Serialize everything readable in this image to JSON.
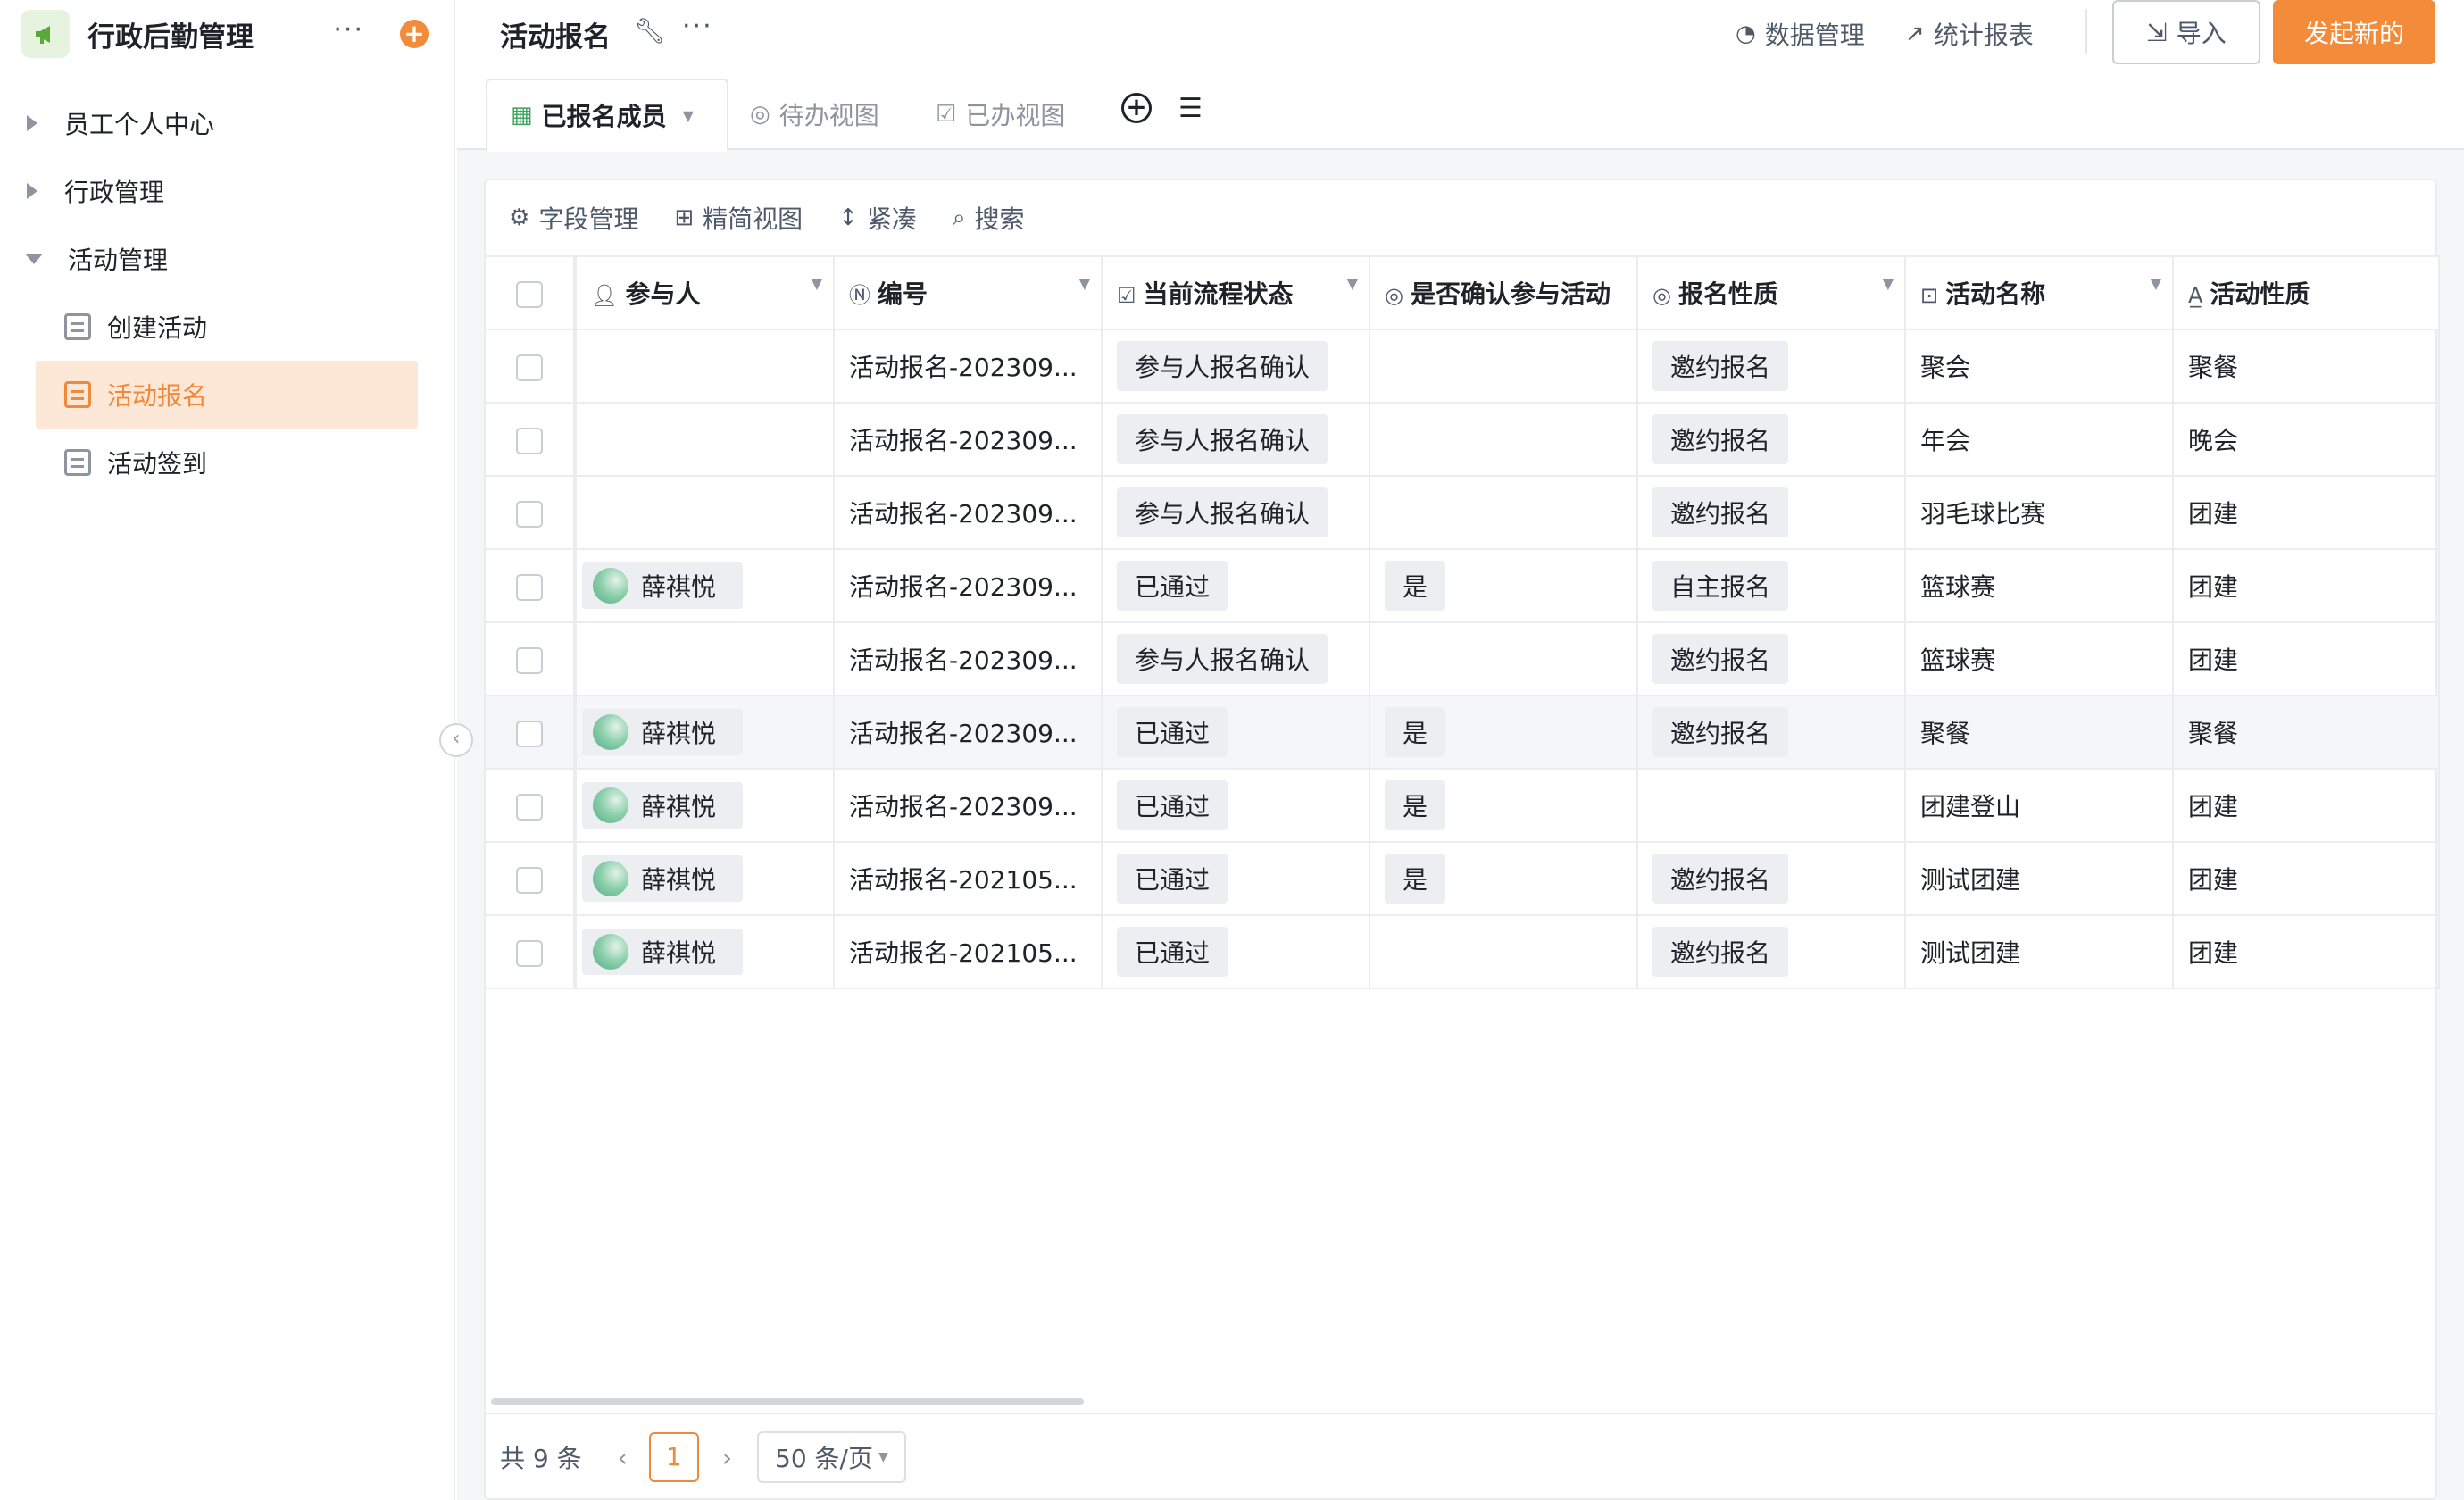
{
  "app": {
    "title": "行政后勤管理",
    "more": "···",
    "add": "+"
  },
  "sidebar": {
    "groups": [
      {
        "label": "员工个人中心"
      },
      {
        "label": "行政管理"
      },
      {
        "label": "活动管理"
      }
    ],
    "subitems": [
      {
        "label": "创建活动"
      },
      {
        "label": "活动报名"
      },
      {
        "label": "活动签到"
      }
    ],
    "active": "活动报名"
  },
  "header": {
    "title": "活动报名",
    "more": "···",
    "data_manage": "数据管理",
    "stats_report": "统计报表",
    "import": "导入",
    "new": "发起新的"
  },
  "tabs": [
    {
      "label": "已报名成员"
    },
    {
      "label": "待办视图"
    },
    {
      "label": "已办视图"
    }
  ],
  "toolbar": {
    "field_manage": "字段管理",
    "simple_view": "精简视图",
    "compact": "紧凑",
    "search": "搜索"
  },
  "table": {
    "columns": [
      {
        "label": "参与人"
      },
      {
        "label": "编号"
      },
      {
        "label": "当前流程状态"
      },
      {
        "label": "是否确认参与活动"
      },
      {
        "label": "报名性质"
      },
      {
        "label": "活动名称"
      },
      {
        "label": "活动性质"
      }
    ],
    "rows": [
      {
        "participant": "",
        "number": "活动报名-202309...",
        "status": "参与人报名确认",
        "confirm": "",
        "nature": "邀约报名",
        "name": "聚会",
        "type": "聚餐"
      },
      {
        "participant": "",
        "number": "活动报名-202309...",
        "status": "参与人报名确认",
        "confirm": "",
        "nature": "邀约报名",
        "name": "年会",
        "type": "晚会"
      },
      {
        "participant": "",
        "number": "活动报名-202309...",
        "status": "参与人报名确认",
        "confirm": "",
        "nature": "邀约报名",
        "name": "羽毛球比赛",
        "type": "团建"
      },
      {
        "participant": "薛祺悦",
        "number": "活动报名-202309...",
        "status": "已通过",
        "confirm": "是",
        "nature": "自主报名",
        "name": "篮球赛",
        "type": "团建"
      },
      {
        "participant": "",
        "number": "活动报名-202309...",
        "status": "参与人报名确认",
        "confirm": "",
        "nature": "邀约报名",
        "name": "篮球赛",
        "type": "团建"
      },
      {
        "participant": "薛祺悦",
        "number": "活动报名-202309...",
        "status": "已通过",
        "confirm": "是",
        "nature": "邀约报名",
        "name": "聚餐",
        "type": "聚餐"
      },
      {
        "participant": "薛祺悦",
        "number": "活动报名-202309...",
        "status": "已通过",
        "confirm": "是",
        "nature": "",
        "name": "团建登山",
        "type": "团建"
      },
      {
        "participant": "薛祺悦",
        "number": "活动报名-202105...",
        "status": "已通过",
        "confirm": "是",
        "nature": "邀约报名",
        "name": "测试团建",
        "type": "团建"
      },
      {
        "participant": "薛祺悦",
        "number": "活动报名-202105...",
        "status": "已通过",
        "confirm": "",
        "nature": "邀约报名",
        "name": "测试团建",
        "type": "团建"
      }
    ]
  },
  "pager": {
    "total": "共 9 条",
    "page": "1",
    "size": "50 条/页"
  },
  "colors": {
    "accent": "#f28b3a",
    "active_bg": "#fde7d6",
    "tag_bg": "#eceef1"
  }
}
